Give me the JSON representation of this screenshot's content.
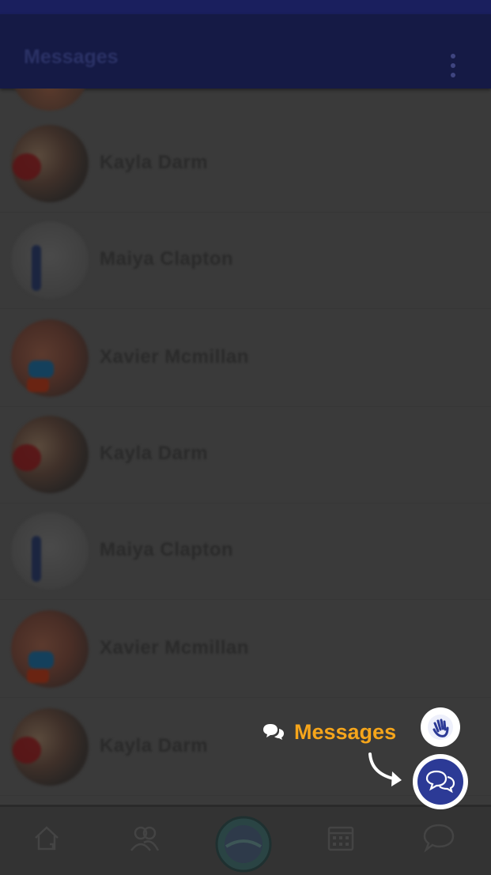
{
  "header": {
    "title": "Messages"
  },
  "contacts": [
    {
      "name": "Kayla Darm",
      "avatar": "kayla"
    },
    {
      "name": "Maiya Clapton",
      "avatar": "maiya"
    },
    {
      "name": "Xavier Mcmillan",
      "avatar": "xavier"
    },
    {
      "name": "Kayla Darm",
      "avatar": "kayla"
    },
    {
      "name": "Maiya Clapton",
      "avatar": "maiya"
    },
    {
      "name": "Xavier Mcmillan",
      "avatar": "xavier"
    },
    {
      "name": "Kayla Darm",
      "avatar": "kayla"
    }
  ],
  "bottom_nav": {
    "items": [
      "home-icon",
      "people-icon",
      "team-logo",
      "calendar-icon",
      "chat-icon"
    ]
  },
  "overlay": {
    "label": "Messages",
    "label_color": "#f5a51b",
    "fab_color": "#2c3a96"
  },
  "colors": {
    "app_bar": "#1a1f5e"
  }
}
